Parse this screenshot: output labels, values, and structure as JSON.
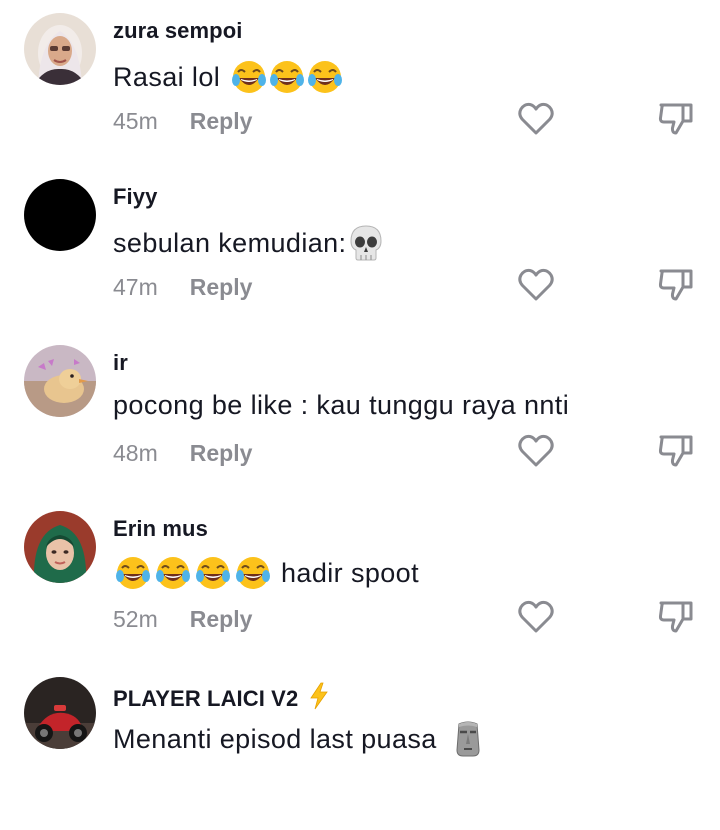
{
  "comments": [
    {
      "username": "zura sempoi",
      "text": "Rasai lol",
      "emojis": [
        "tears-of-joy-emoji",
        "tears-of-joy-emoji",
        "tears-of-joy-emoji"
      ],
      "time": "45m",
      "reply_label": "Reply",
      "avatar": "avatar-hijab-woman"
    },
    {
      "username": "Fiyy",
      "text": "sebulan kemudian:",
      "emojis": [
        "skull-emoji"
      ],
      "time": "47m",
      "reply_label": "Reply",
      "avatar": "avatar-black"
    },
    {
      "username": "ir",
      "text": "pocong be like : kau tunggu raya nnti",
      "emojis": [],
      "time": "48m",
      "reply_label": "Reply",
      "avatar": "avatar-duck"
    },
    {
      "username": "Erin mus",
      "text": "hadir spoot",
      "emojis": [
        "tears-of-joy-emoji",
        "tears-of-joy-emoji",
        "tears-of-joy-emoji",
        "tears-of-joy-emoji"
      ],
      "time": "52m",
      "reply_label": "Reply",
      "avatar": "avatar-green-hijab"
    },
    {
      "username": "PLAYER LAICI V2",
      "text": "Menanti episod last puasa",
      "emojis": [
        "moai-emoji"
      ],
      "time": "",
      "reply_label": "",
      "avatar": "avatar-motorbike",
      "username_badge": "lightning-emoji"
    }
  ],
  "icons": {
    "like": "heart-outline-icon",
    "dislike": "thumbs-down-outline-icon"
  },
  "colors": {
    "username": "#161823",
    "text": "#161823",
    "meta": "#8a8b91",
    "icon": "#8a8b91"
  }
}
